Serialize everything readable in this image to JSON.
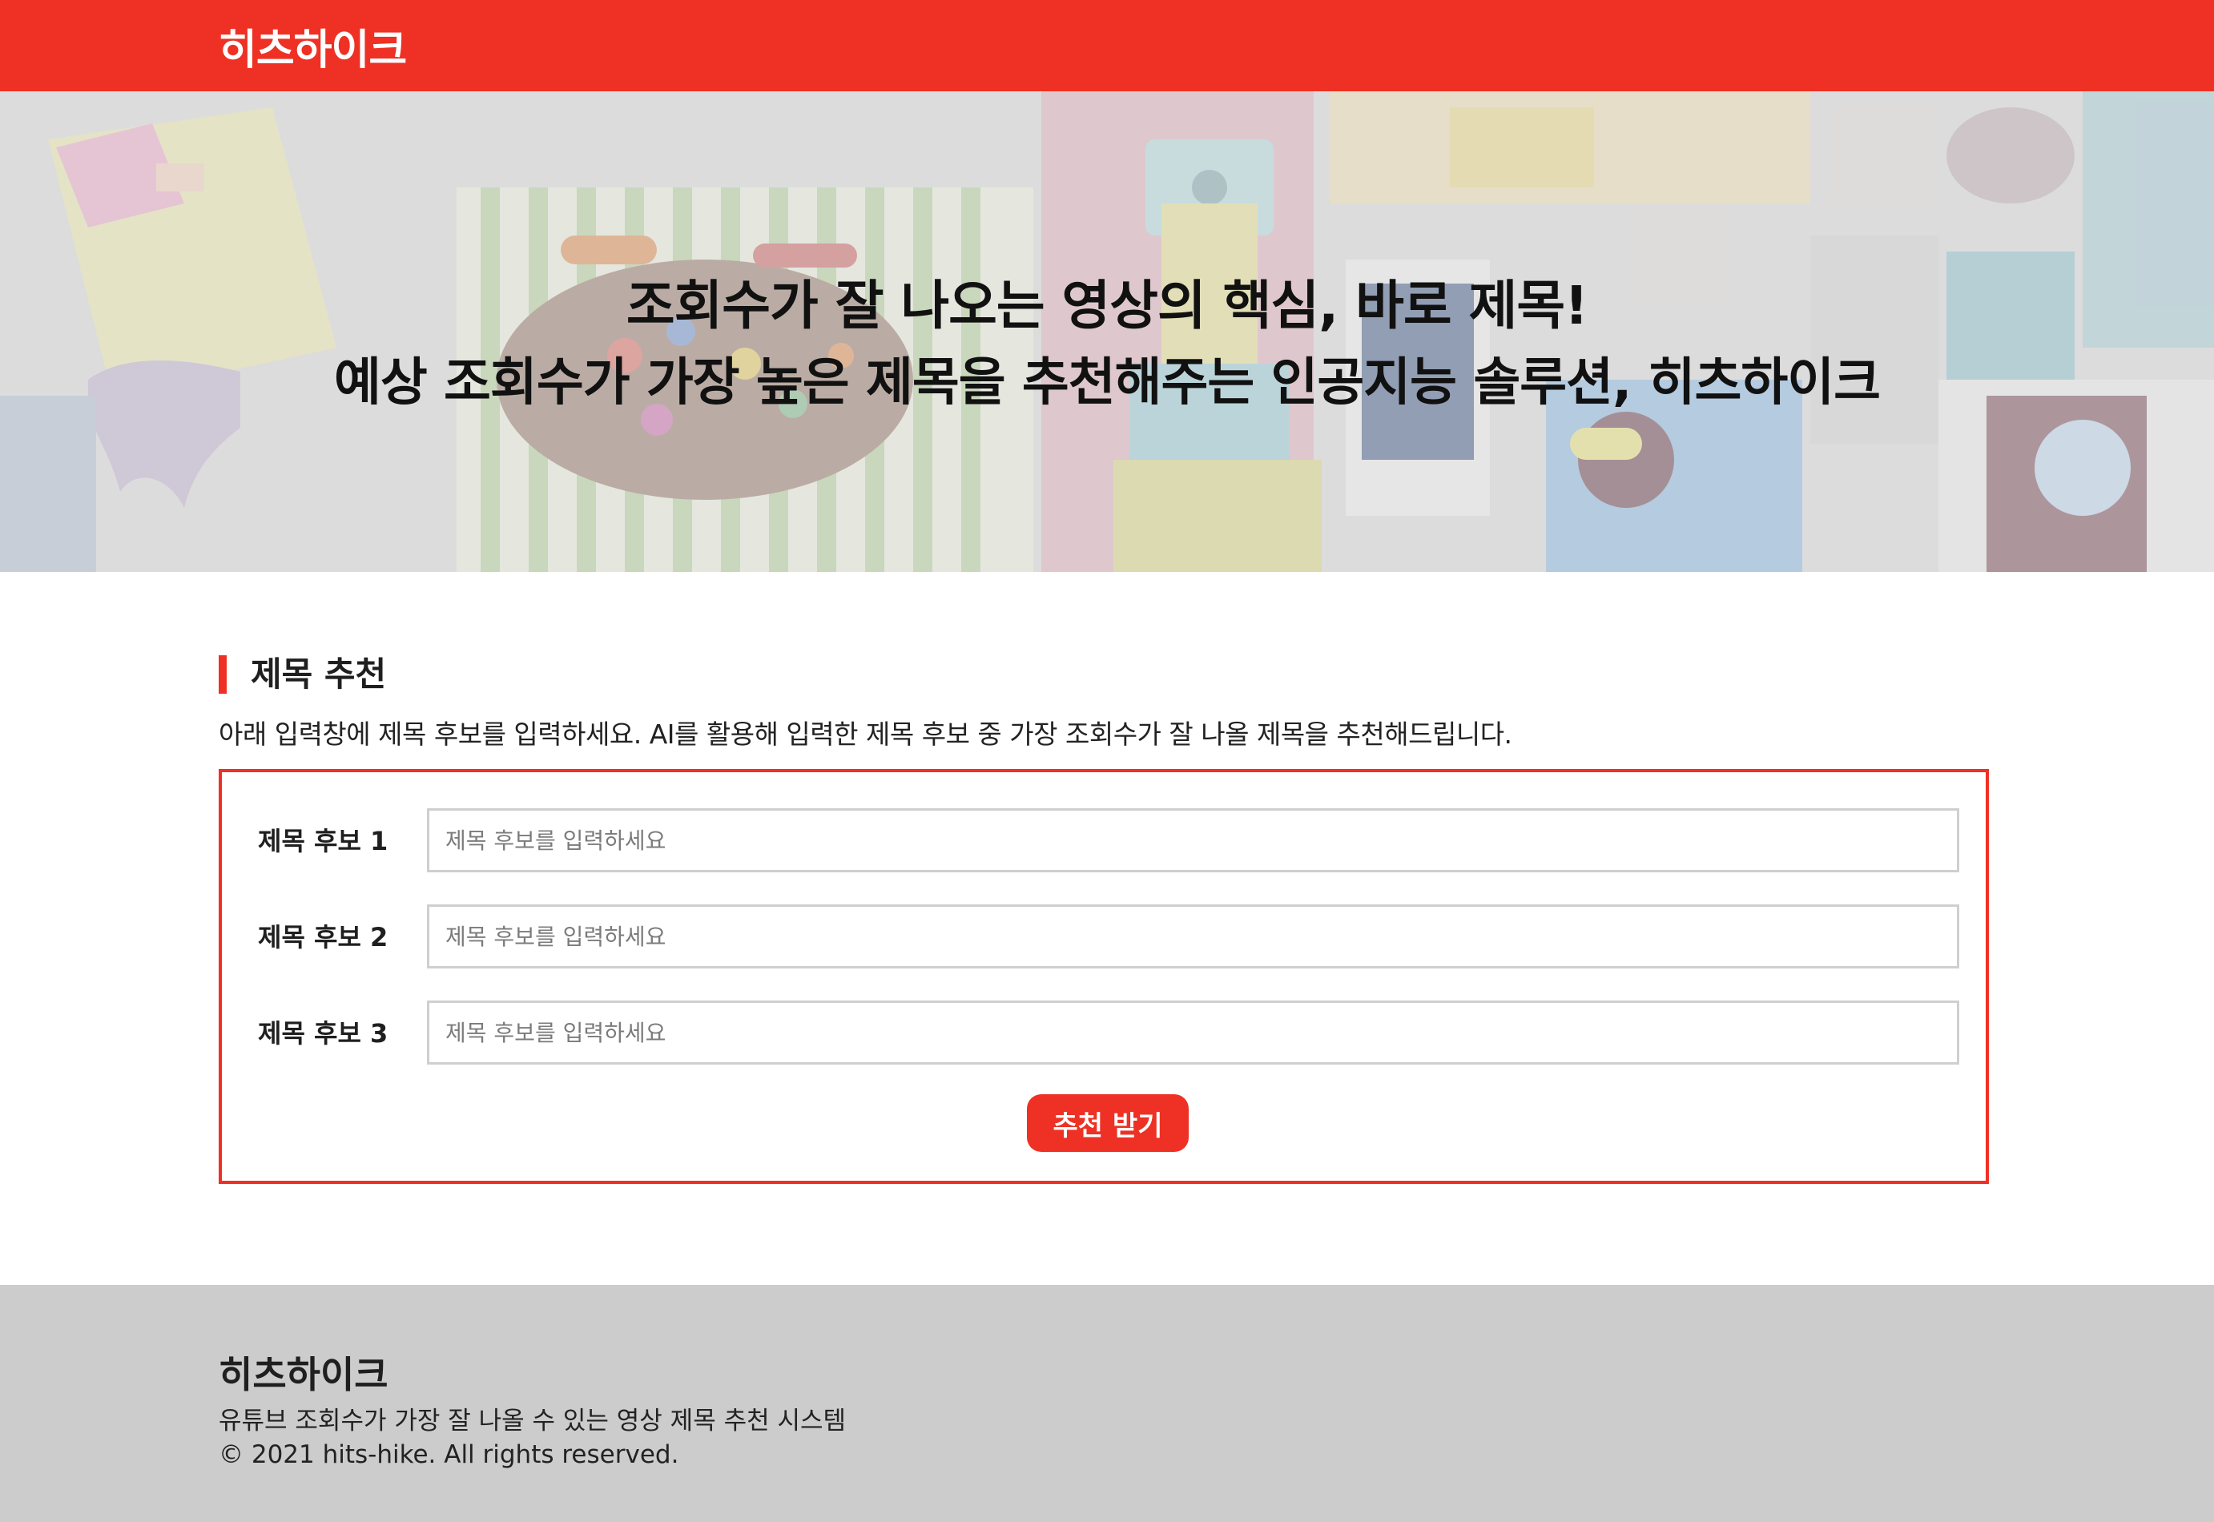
{
  "header": {
    "brand": "히츠하이크"
  },
  "hero": {
    "line1": "조회수가 잘 나오는 영상의 핵심, 바로 제목!",
    "line2": "예상 조회수가 가장 높은 제목을 추천해주는 인공지능 솔루션, 히츠하이크"
  },
  "section": {
    "title": "제목 추천",
    "description": "아래 입력창에 제목 후보를 입력하세요. AI를 활용해 입력한 제목 후보 중 가장 조회수가 잘 나올 제목을 추천해드립니다."
  },
  "form": {
    "rows": [
      {
        "label": "제목 후보 1",
        "placeholder": "제목 후보를 입력하세요",
        "value": ""
      },
      {
        "label": "제목 후보 2",
        "placeholder": "제목 후보를 입력하세요",
        "value": ""
      },
      {
        "label": "제목 후보 3",
        "placeholder": "제목 후보를 입력하세요",
        "value": ""
      }
    ],
    "submit_label": "추천 받기"
  },
  "footer": {
    "brand": "히츠하이크",
    "description": "유튜브 조회수가 가장 잘 나올 수 있는 영상 제목 추천 시스템",
    "copyright": "© 2021 hits-hike. All rights reserved."
  },
  "colors": {
    "accent": "#ee3124",
    "footer_bg": "#cccccc",
    "input_border": "#cfcfcf"
  }
}
